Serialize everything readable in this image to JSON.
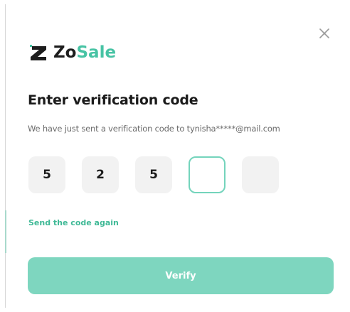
{
  "brand": {
    "name_part1": "Zo",
    "name_part2": "Sale",
    "logo_icon": "zosale-z-logo-icon",
    "accent_color": "#47c3a4"
  },
  "dialog": {
    "close_icon": "close-icon",
    "title": "Enter verification code",
    "subtitle": "We have just sent a verification code to tynisha*****@mail.com",
    "code_digits": [
      "5",
      "2",
      "5",
      "",
      ""
    ],
    "active_index": 3,
    "resend_label": "Send the code again",
    "verify_label": "Verify",
    "verify_button_color": "#7ed6bf"
  }
}
